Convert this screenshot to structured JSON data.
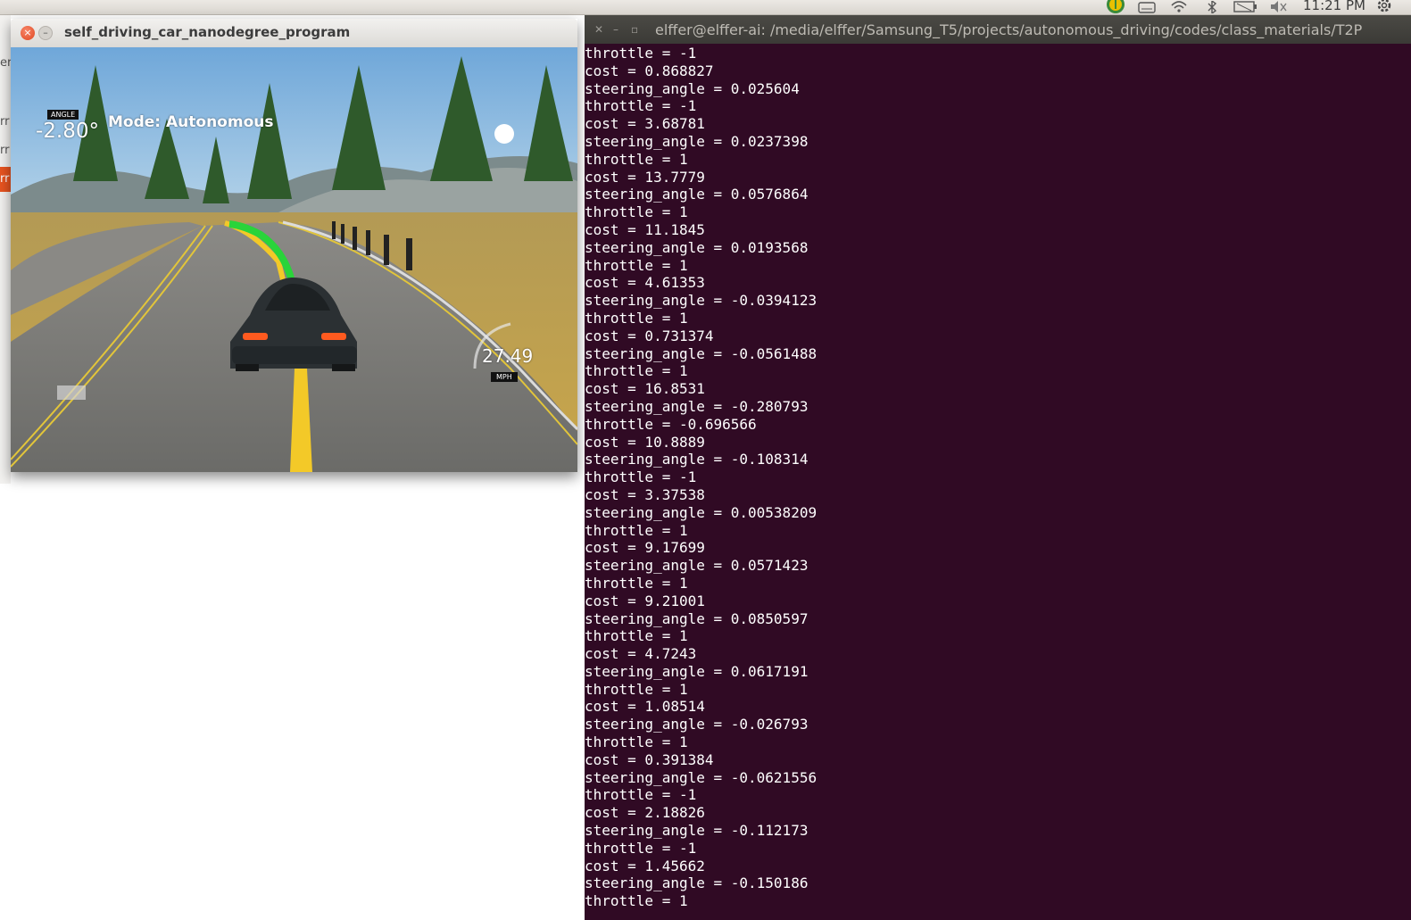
{
  "top_panel": {
    "clock": "11:21 PM",
    "tray_icons": [
      "ubuntu-one-icon",
      "keyboard-icon",
      "wifi-icon",
      "bluetooth-icon",
      "battery-icon",
      "volume-muted-icon",
      "gear-icon"
    ]
  },
  "background_window": {
    "fragments": [
      "er",
      "rr",
      "rr",
      "rr"
    ]
  },
  "simulator": {
    "title": "self_driving_car_nanodegree_program",
    "hud": {
      "angle_label": "ANGLE",
      "angle_value": "-2.80°",
      "mode": "Mode: Autonomous",
      "speed_value": "27.49",
      "speed_unit": "MPH"
    }
  },
  "terminal": {
    "title": "elffer@elffer-ai: /media/elffer/Samsung_T5/projects/autonomous_driving/codes/class_materials/T2P",
    "lines": [
      "throttle = -1",
      "cost = 0.868827",
      "steering_angle = 0.025604",
      "throttle = -1",
      "cost = 3.68781",
      "steering_angle = 0.0237398",
      "throttle = 1",
      "cost = 13.7779",
      "steering_angle = 0.0576864",
      "throttle = 1",
      "cost = 11.1845",
      "steering_angle = 0.0193568",
      "throttle = 1",
      "cost = 4.61353",
      "steering_angle = -0.0394123",
      "throttle = 1",
      "cost = 0.731374",
      "steering_angle = -0.0561488",
      "throttle = 1",
      "cost = 16.8531",
      "steering_angle = -0.280793",
      "throttle = -0.696566",
      "cost = 10.8889",
      "steering_angle = -0.108314",
      "throttle = -1",
      "cost = 3.37538",
      "steering_angle = 0.00538209",
      "throttle = 1",
      "cost = 9.17699",
      "steering_angle = 0.0571423",
      "throttle = 1",
      "cost = 9.21001",
      "steering_angle = 0.0850597",
      "throttle = 1",
      "cost = 4.7243",
      "steering_angle = 0.0617191",
      "throttle = 1",
      "cost = 1.08514",
      "steering_angle = -0.026793",
      "throttle = 1",
      "cost = 0.391384",
      "steering_angle = -0.0621556",
      "throttle = -1",
      "cost = 2.18826",
      "steering_angle = -0.112173",
      "throttle = -1",
      "cost = 1.45662",
      "steering_angle = -0.150186",
      "throttle = 1"
    ]
  }
}
